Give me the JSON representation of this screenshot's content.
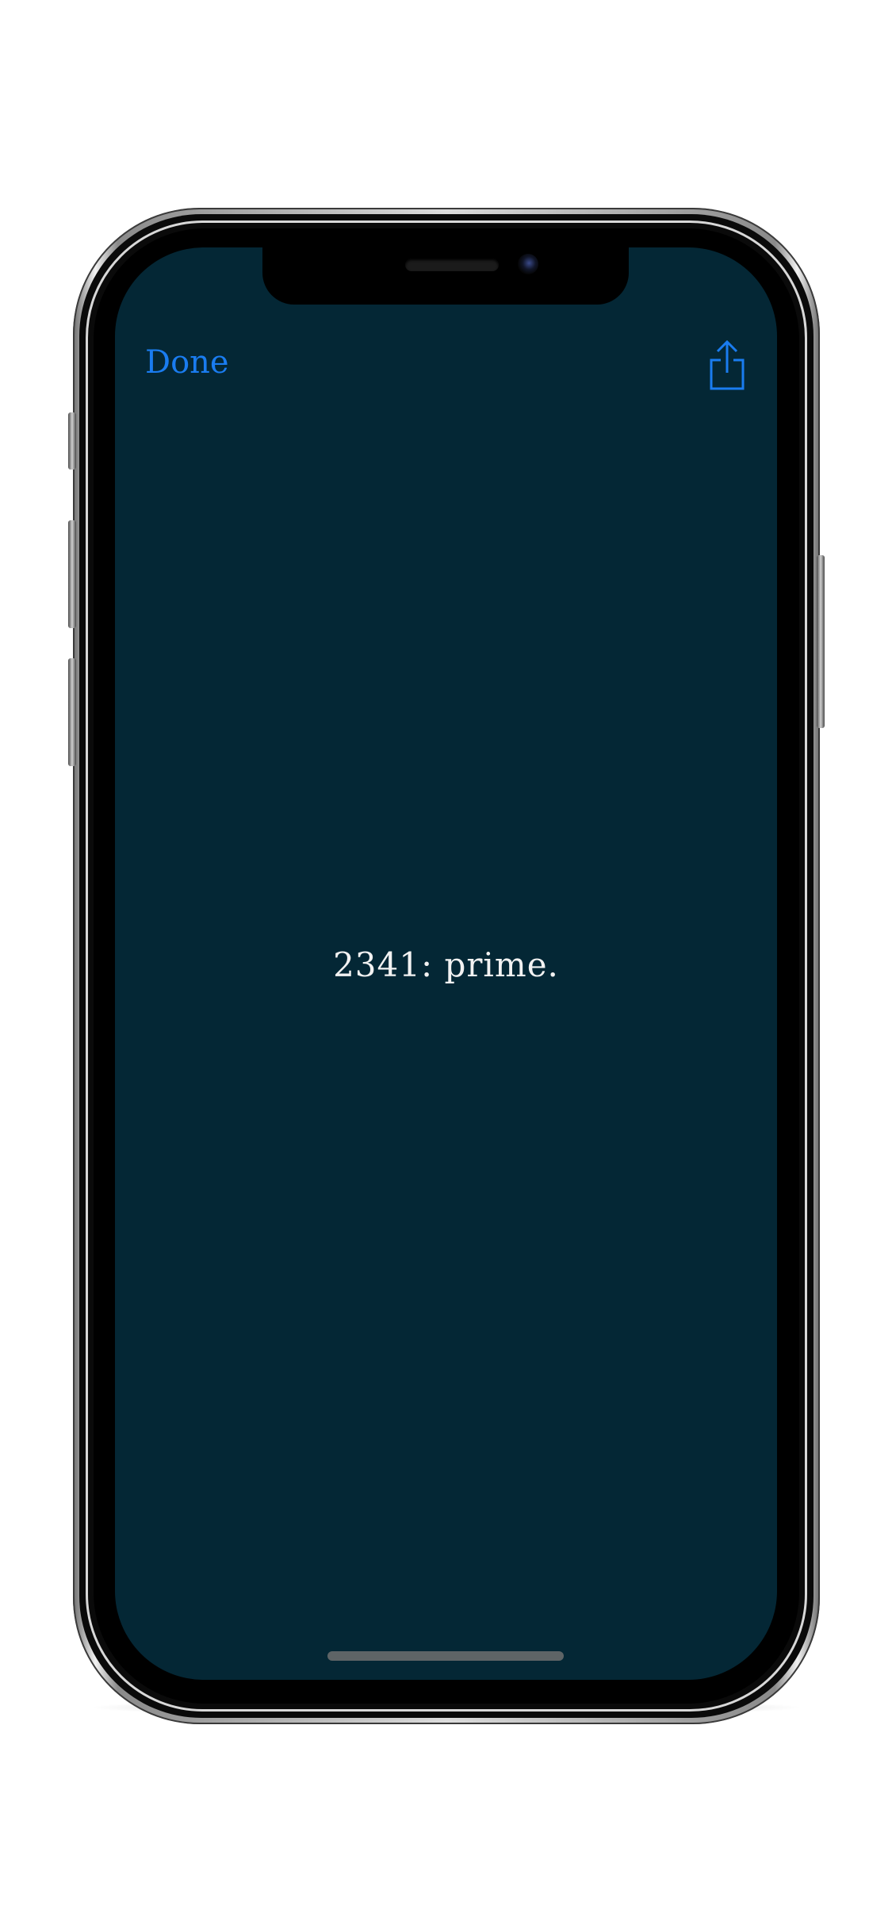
{
  "toolbar": {
    "done_label": "Done",
    "share_icon": "share-icon",
    "accent_color": "#1a7cf0"
  },
  "main": {
    "result_text": "2341: prime."
  },
  "theme": {
    "background": "#042735",
    "text_color": "#f2f2f2"
  }
}
